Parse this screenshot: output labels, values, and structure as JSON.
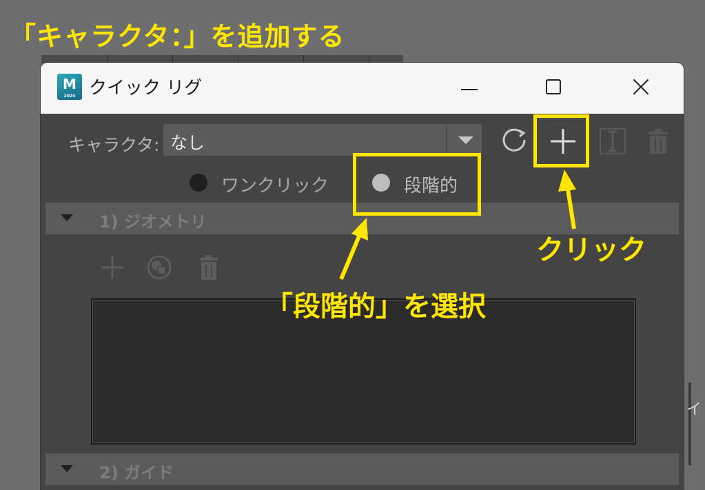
{
  "annotation": {
    "title": "「キャラクタ：」を追加する",
    "click_note": "クリック",
    "select_note": "「段階的」を選択",
    "accent_color": "#ffe600"
  },
  "window": {
    "app_icon_letter": "M",
    "app_icon_subtext": "2024",
    "title": "クイック リグ",
    "controls": [
      "minimize-icon",
      "maximize-icon",
      "close-icon"
    ]
  },
  "character": {
    "label": "キャラクタ:",
    "selected": "なし"
  },
  "toolbar_icons": [
    "refresh-icon",
    "add-icon",
    "select-joint-icon",
    "trash-icon"
  ],
  "mode": {
    "options": [
      {
        "label": "ワンクリック",
        "selected": false
      },
      {
        "label": "段階的",
        "selected": true
      }
    ]
  },
  "sections": {
    "geometry": {
      "label": "1) ジオメトリ",
      "tool_icons": [
        "add-icon",
        "replace-icon",
        "trash-icon"
      ]
    },
    "guide": {
      "label": "2) ガイド"
    }
  },
  "edge_glyph": "イ"
}
